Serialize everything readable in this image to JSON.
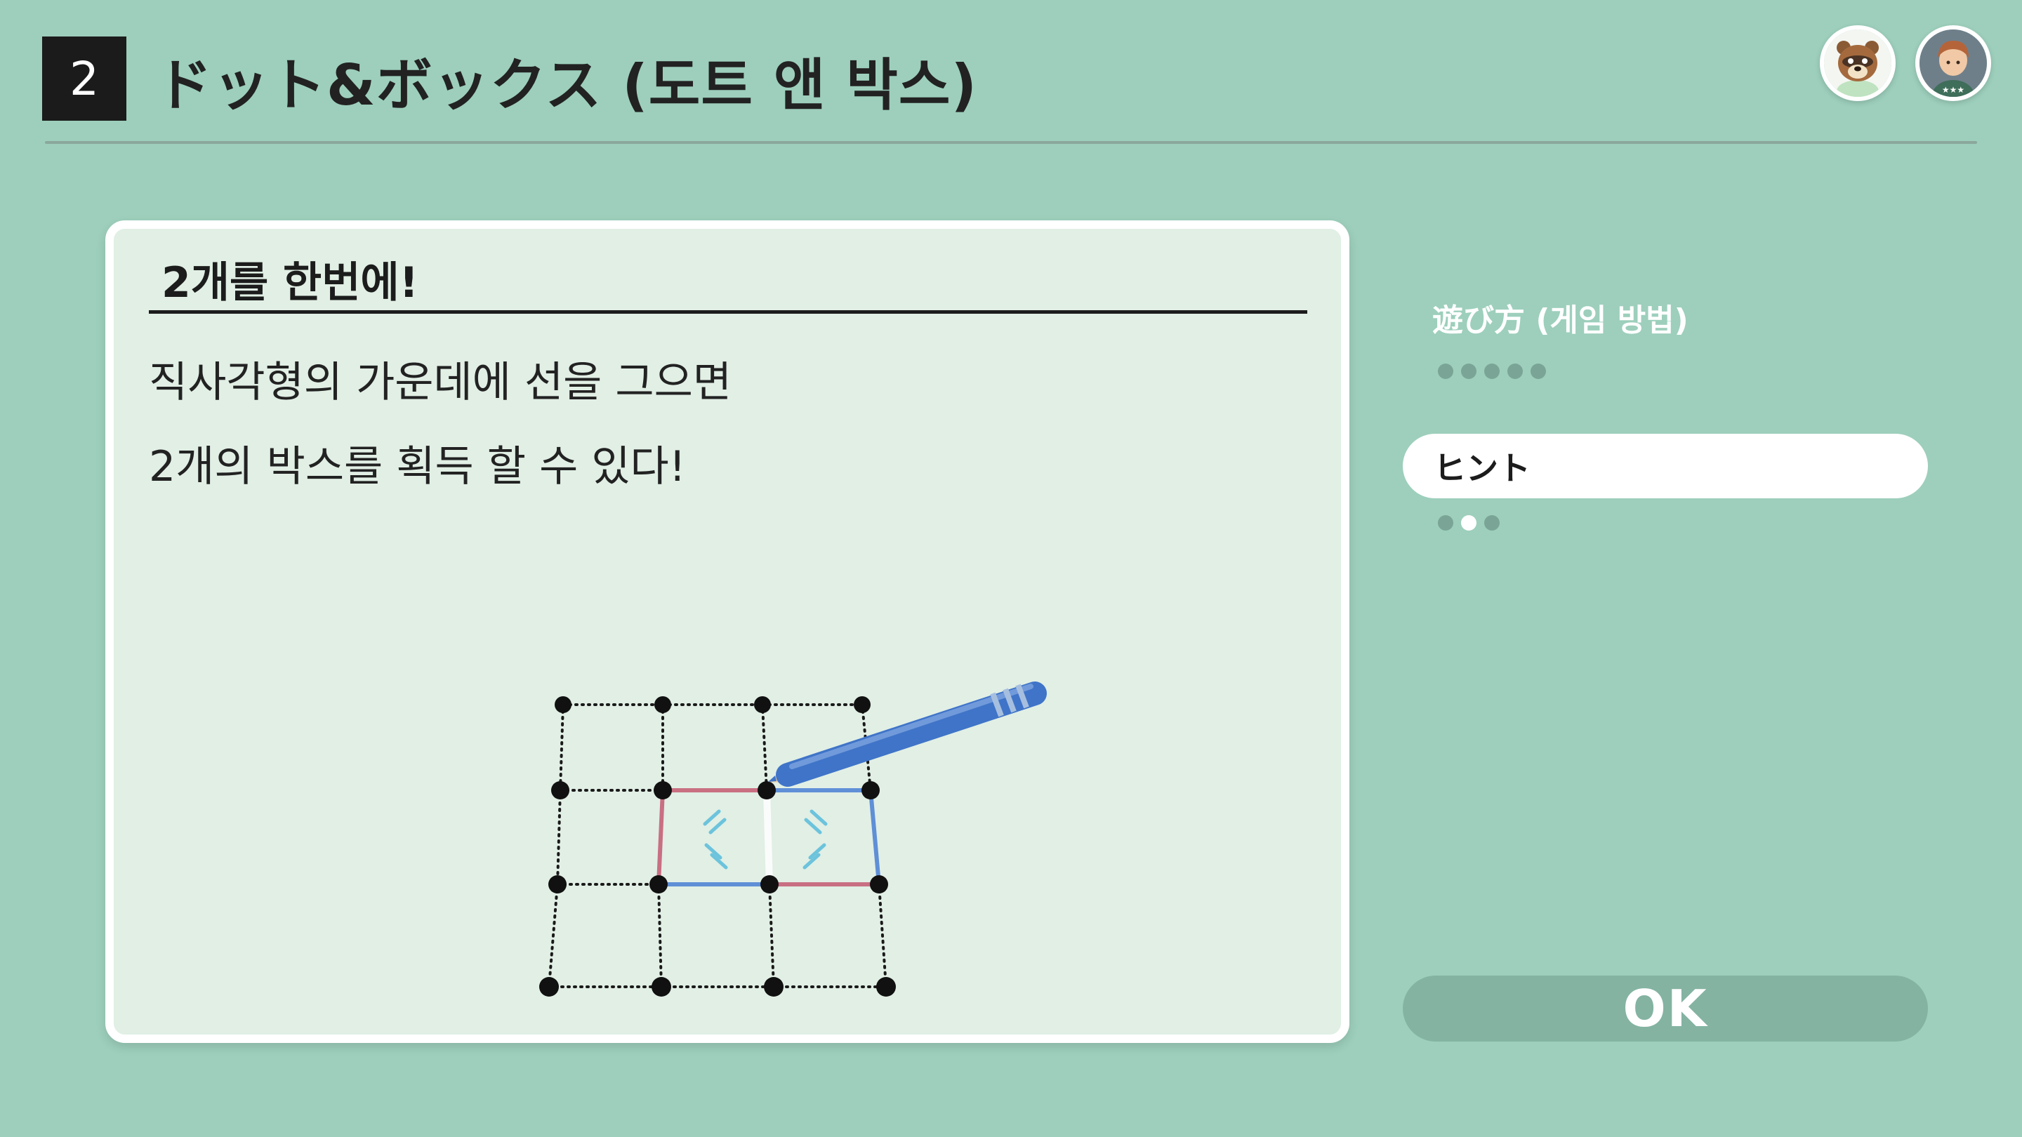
{
  "header": {
    "number": "2",
    "title": "ドット&ボックス (도트 앤 박스)"
  },
  "card": {
    "title": "2개를 한번에!",
    "lines": [
      "직사각형의 가운데에 선을 그으면",
      "2개의 박스를 획득 할 수 있다!"
    ]
  },
  "menu": {
    "how_to_play": {
      "label": "遊び方 (게임 방법)",
      "pages": 5,
      "current_page": 0
    },
    "hint": {
      "label": "ヒント",
      "pages": 3,
      "current_page": 2
    }
  },
  "ok_button": {
    "label": "OK"
  },
  "colors": {
    "background": "#9dcfbc",
    "card": "#e1efe5",
    "red_line": "#c96f83",
    "blue_line": "#5f8fd6",
    "pencil": "#3f74c8"
  },
  "icons": [
    "tom-nook-avatar-icon",
    "villager-avatar-icon",
    "pencil-icon",
    "sparkle-icon"
  ]
}
